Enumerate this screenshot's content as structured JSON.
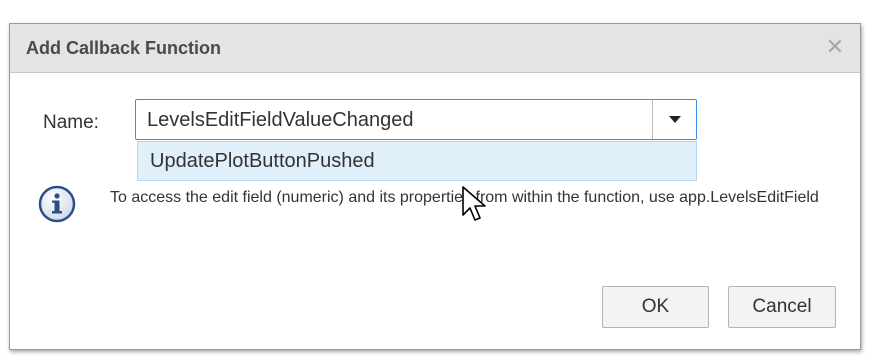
{
  "dialog": {
    "title": "Add Callback Function",
    "close_icon": "close-icon"
  },
  "name_field": {
    "label": "Name:",
    "value": "LevelsEditFieldValueChanged",
    "arrow_icon": "chevron-down-icon"
  },
  "dropdown": {
    "options": [
      "UpdatePlotButtonPushed"
    ]
  },
  "info": {
    "icon": "info-icon",
    "text": "To access the edit field (numeric) and its properties from within the function, use app.LevelsEditField"
  },
  "buttons": {
    "ok_label": "OK",
    "cancel_label": "Cancel"
  },
  "colors": {
    "accent": "#3a8ee6",
    "highlight": "#dff0fb",
    "title_bar": "#e4e4e4"
  }
}
